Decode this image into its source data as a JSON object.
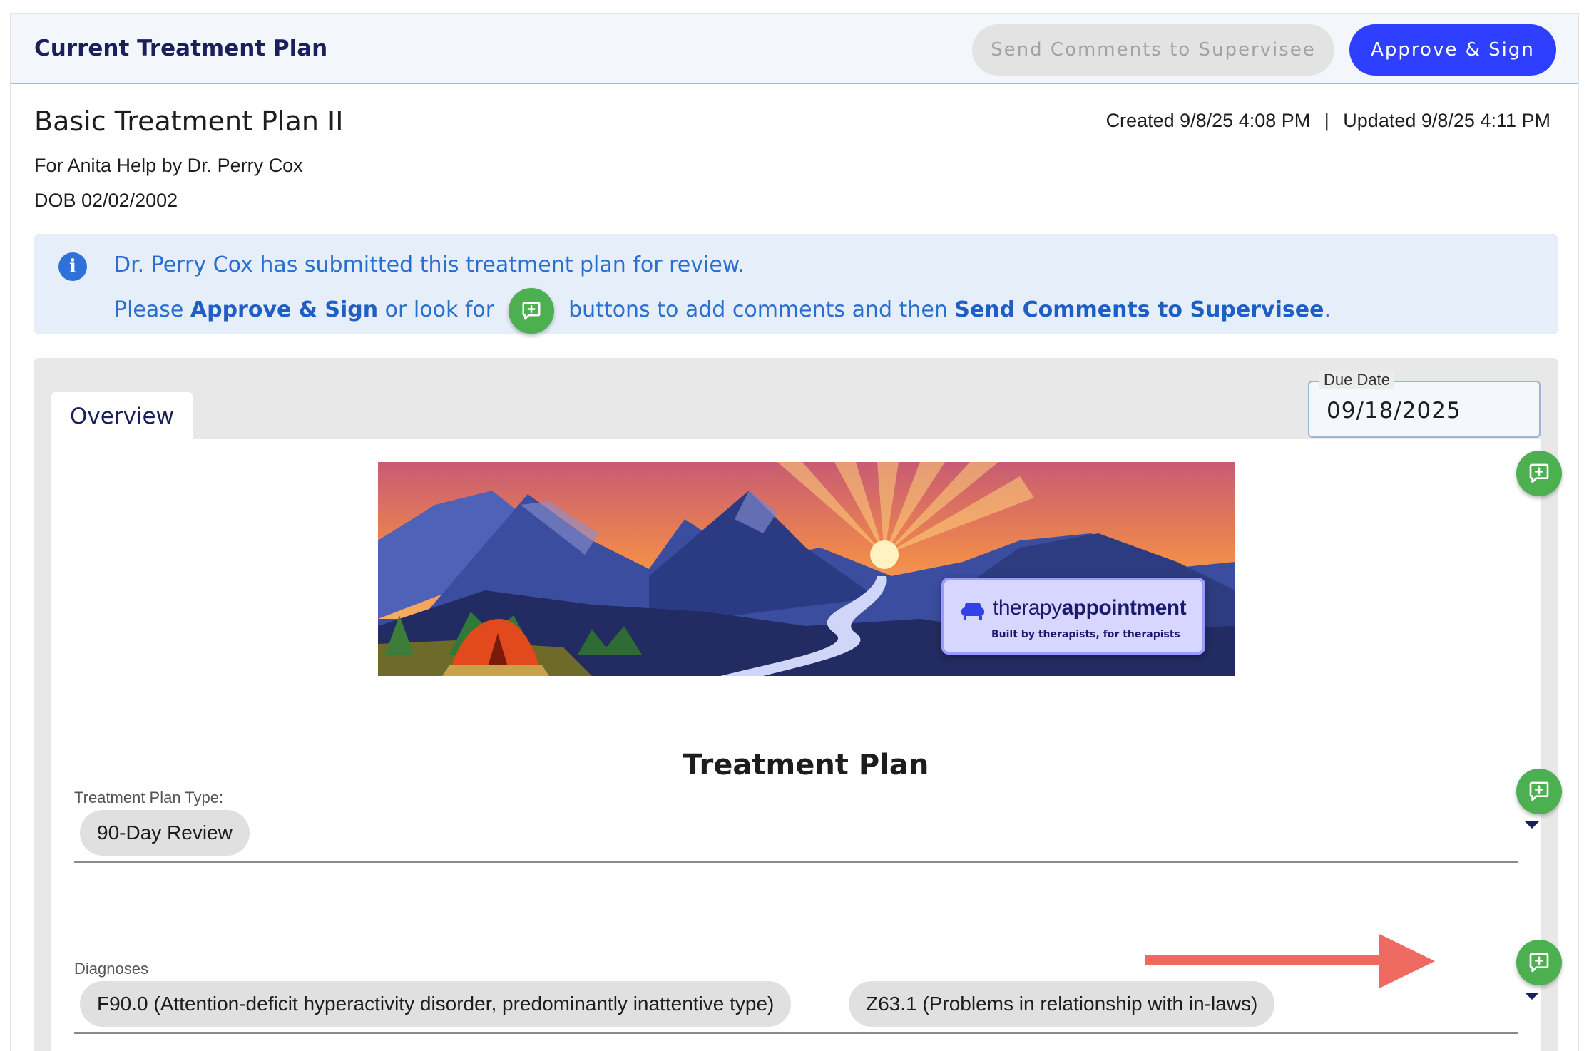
{
  "header": {
    "title": "Current Treatment Plan",
    "send_comments_label": "Send Comments to Supervisee",
    "approve_label": "Approve & Sign"
  },
  "plan": {
    "title": "Basic Treatment Plan II",
    "for_line": "For Anita Help by Dr. Perry Cox",
    "dob": "DOB 02/02/2002",
    "created": "Created 9/8/25 4:08 PM",
    "separator": "|",
    "updated": "Updated 9/8/25 4:11 PM"
  },
  "info": {
    "line1": "Dr. Perry Cox has submitted this treatment plan for review.",
    "line2_a": "Please ",
    "line2_approve": "Approve & Sign",
    "line2_b": " or look for",
    "line2_c": "buttons to add comments and then ",
    "line2_send": "Send Comments to Supervisee",
    "line2_end": "."
  },
  "tabs": [
    {
      "label": "Overview"
    }
  ],
  "due_date": {
    "label": "Due Date",
    "value": "09/18/2025"
  },
  "banner": {
    "logo_light": "therapy",
    "logo_bold": "appointment",
    "tagline": "Built by therapists, for therapists"
  },
  "form": {
    "section_title": "Treatment Plan",
    "type_label": "Treatment Plan Type:",
    "type_value": "90-Day Review",
    "diagnoses_label": "Diagnoses",
    "diagnoses": [
      "F90.0 (Attention-deficit hyperactivity disorder, predominantly inattentive type)",
      "Z63.1 (Problems in relationship with in-laws)"
    ]
  },
  "colors": {
    "primary": "#2f3fff",
    "comment_green": "#4caf50",
    "info_blue": "#2a6fd0",
    "arrow": "#ef6b62"
  },
  "icons": {
    "info": "info-icon",
    "comment": "add-comment-icon",
    "dropdown": "caret-down-icon"
  }
}
